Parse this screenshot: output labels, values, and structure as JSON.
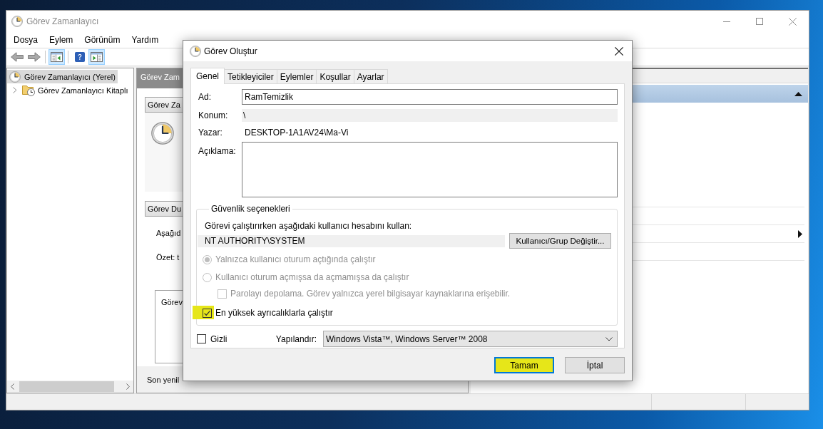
{
  "window": {
    "title": "Görev Zamanlayıcı"
  },
  "menu": [
    {
      "label": "Dosya"
    },
    {
      "label": "Eylem"
    },
    {
      "label": "Görünüm"
    },
    {
      "label": "Yardım"
    }
  ],
  "toolbar": [
    [
      {
        "kind": "back",
        "disabled": true,
        "pressed": false
      },
      {
        "kind": "forward",
        "disabled": true,
        "pressed": false
      }
    ],
    [
      {
        "kind": "console-tree",
        "disabled": false,
        "pressed": true
      }
    ],
    [
      {
        "kind": "help",
        "disabled": false,
        "pressed": false
      },
      {
        "kind": "action-pane",
        "disabled": false,
        "pressed": true
      }
    ]
  ],
  "tree": [
    {
      "label": "Görev Zamanlayıcı (Yerel)",
      "selected": true,
      "children": [
        {
          "label": "Görev Zamanlayıcı Kitaplı",
          "selected": false,
          "expanded": false
        }
      ]
    }
  ],
  "center_pane": {
    "title": "Görev Zam",
    "sections": [
      {
        "kind": "overview",
        "title": "Görev Za"
      },
      {
        "kind": "status",
        "title": "Görev Du",
        "lines": [
          "Aşağıd",
          "Özet: t"
        ],
        "list_text": "Görev"
      }
    ],
    "footer": "Son yenil"
  },
  "actions_pane": {
    "expanded": true
  },
  "dialog": {
    "title": "Görev Oluştur",
    "tabs": [
      {
        "label": "Genel",
        "selected": true
      },
      {
        "label": "Tetikleyiciler",
        "selected": false
      },
      {
        "label": "Eylemler",
        "selected": false
      },
      {
        "label": "Koşullar",
        "selected": false
      },
      {
        "label": "Ayarlar",
        "selected": false
      }
    ],
    "fields": [
      {
        "kind": "input",
        "label": "Ad:",
        "value": "RamTemizlik"
      },
      {
        "kind": "readonly",
        "label": "Konum:",
        "value": "\\"
      },
      {
        "kind": "text",
        "label": "Yazar:",
        "value": "DESKTOP-1A1AV24\\Ma-Vi"
      },
      {
        "kind": "textarea",
        "label": "Açıklama:"
      }
    ],
    "security": {
      "title": "Güvenlik seçenekleri",
      "prompt": "Görevi çalıştırırken aşağıdaki kullanıcı hesabını kullan:",
      "account": "NT AUTHORITY\\SYSTEM",
      "change_button": "Kullanıcı/Grup Değiştir...",
      "options": [
        {
          "kind": "radio",
          "label": "Yalnızca kullanıcı oturum açtığında çalıştır",
          "selected": true,
          "disabled": true,
          "highlighted": false
        },
        {
          "kind": "radio",
          "label": "Kullanıcı oturum açmışsa da açmamışsa da çalıştır",
          "selected": false,
          "disabled": true,
          "highlighted": false,
          "children": [
            {
              "kind": "checkbox",
              "label": "Parolayı depolama. Görev yalnızca yerel bilgisayar kaynaklarına erişebilir.",
              "checked": false,
              "disabled": true,
              "highlighted": false
            }
          ]
        },
        {
          "kind": "checkbox",
          "label": "En yüksek ayrıcalıklarla çalıştır",
          "checked": true,
          "disabled": false,
          "highlighted": true
        }
      ]
    },
    "hidden": {
      "label": "Gizli",
      "checked": false
    },
    "configure": {
      "label": "Yapılandır:",
      "value": "Windows Vista™, Windows Server™ 2008"
    },
    "buttons": [
      {
        "label": "Tamam",
        "default": true,
        "highlighted": true
      },
      {
        "label": "İptal",
        "default": false,
        "highlighted": false
      }
    ]
  }
}
